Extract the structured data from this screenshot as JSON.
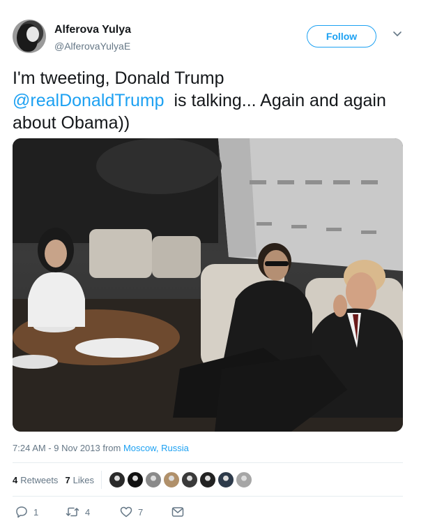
{
  "author": {
    "display_name": "Alferova Yulya",
    "handle": "@AlferovaYulyaE"
  },
  "follow_label": "Follow",
  "tweet": {
    "text_before": "I'm tweeting, Donald Trump",
    "mention": "@realDonaldTrump",
    "text_after": "is talking... Again and again about Obama))"
  },
  "meta": {
    "timestamp": "7:24 AM - 9 Nov 2013 from ",
    "location": "Moscow, Russia"
  },
  "stats": {
    "retweets_count": "4",
    "retweets_label": "Retweets",
    "likes_count": "7",
    "likes_label": "Likes",
    "likers": [
      {
        "color": "#2a2a2a"
      },
      {
        "color": "#111111"
      },
      {
        "color": "#8a8a8a"
      },
      {
        "color": "#b0906a"
      },
      {
        "color": "#3a3a3a"
      },
      {
        "color": "#222222"
      },
      {
        "color": "#2d3a4a"
      },
      {
        "color": "#a6a6a6"
      }
    ]
  },
  "actions": {
    "reply_count": "1",
    "retweet_count": "4",
    "like_count": "7"
  },
  "colors": {
    "accent": "#1da1f2",
    "secondary_text": "#657786",
    "primary_text": "#14171a"
  }
}
